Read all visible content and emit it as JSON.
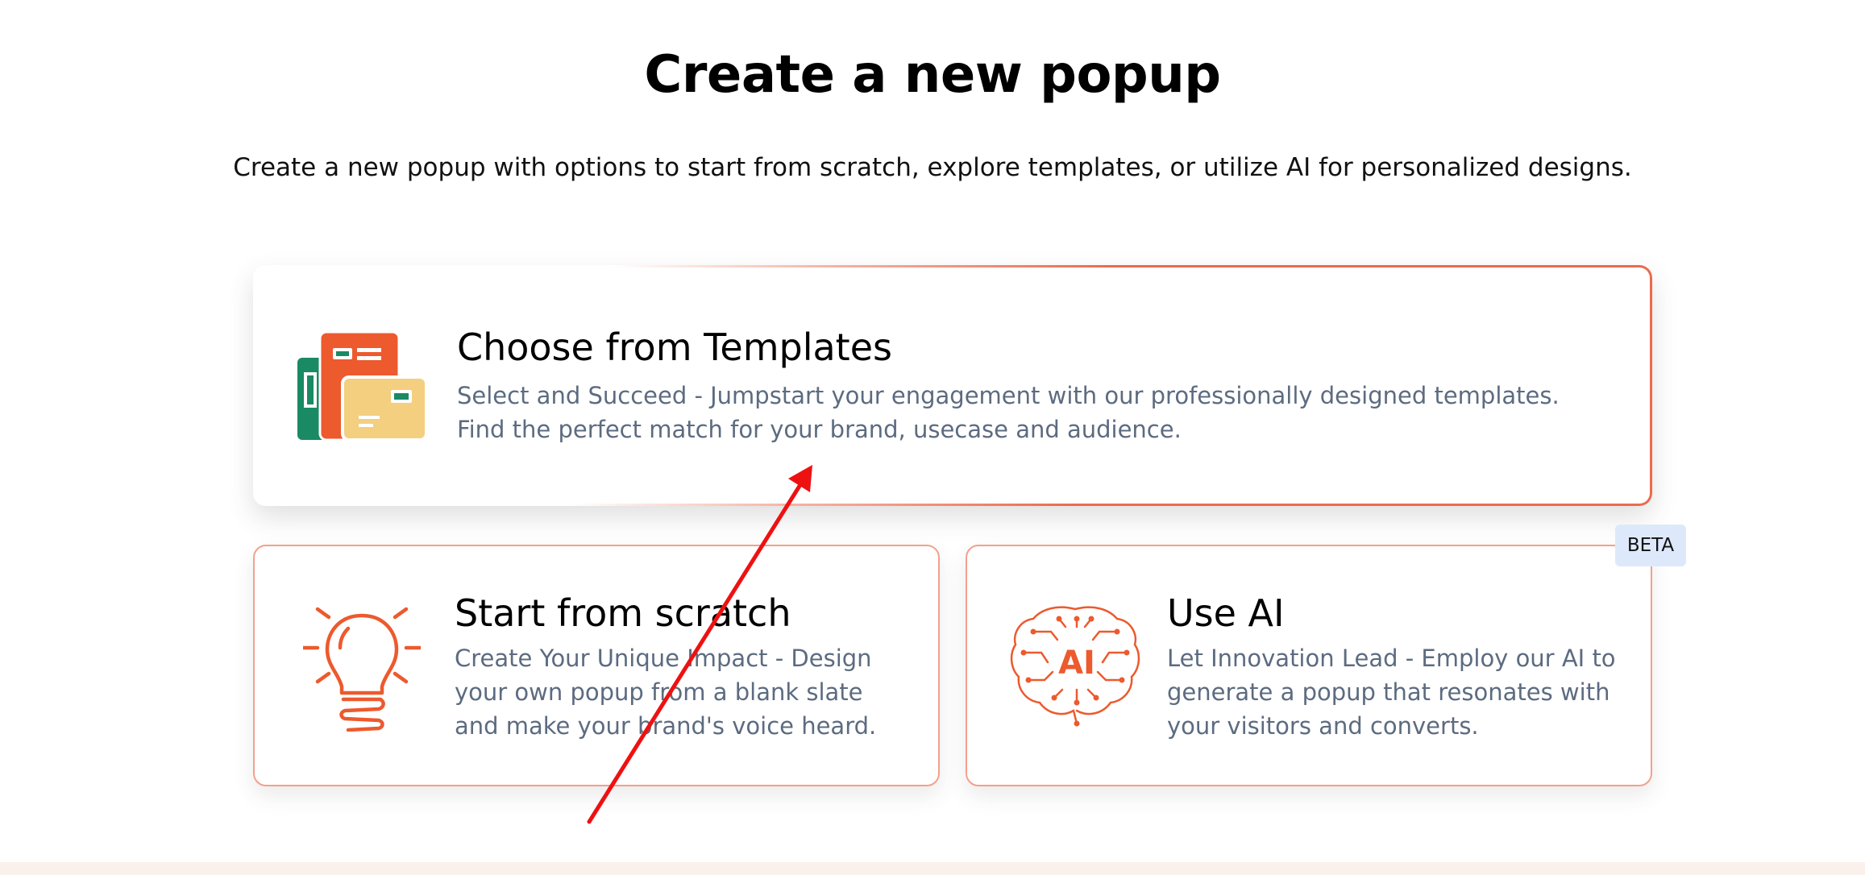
{
  "header": {
    "title": "Create a new popup",
    "subtitle": "Create a new popup with options to start from scratch, explore templates, or utilize AI for personalized designs."
  },
  "cards": {
    "templates": {
      "title": "Choose from Templates",
      "description": "Select and Succeed - Jumpstart your engagement with our professionally designed templates. Find the perfect match for your brand, usecase and audience.",
      "icon": "templates-icon"
    },
    "scratch": {
      "title": "Start from scratch",
      "description": "Create Your Unique Impact - Design your own popup from a blank slate and make your brand's voice heard.",
      "icon": "lightbulb-icon"
    },
    "ai": {
      "title": "Use AI",
      "description": "Let Innovation Lead - Employ our AI to generate a popup that resonates with your visitors and converts.",
      "icon": "ai-brain-icon",
      "badge": "BETA"
    }
  },
  "colors": {
    "accent": "#ec5a2e",
    "border": "#f4a08c",
    "description_text": "#5c6b80",
    "badge_bg": "#dde9fb",
    "annotation_arrow": "#ee1111"
  },
  "annotation": {
    "type": "red-arrow",
    "target": "templates-card"
  }
}
